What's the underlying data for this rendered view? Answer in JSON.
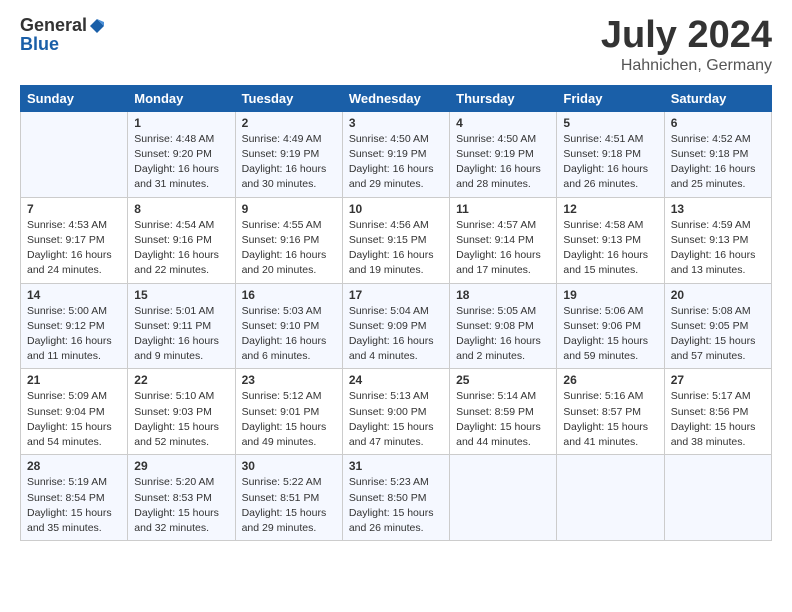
{
  "header": {
    "logo_general": "General",
    "logo_blue": "Blue",
    "month_title": "July 2024",
    "location": "Hahnichen, Germany"
  },
  "days_of_week": [
    "Sunday",
    "Monday",
    "Tuesday",
    "Wednesday",
    "Thursday",
    "Friday",
    "Saturday"
  ],
  "weeks": [
    [
      {
        "day": "",
        "info": ""
      },
      {
        "day": "1",
        "info": "Sunrise: 4:48 AM\nSunset: 9:20 PM\nDaylight: 16 hours\nand 31 minutes."
      },
      {
        "day": "2",
        "info": "Sunrise: 4:49 AM\nSunset: 9:19 PM\nDaylight: 16 hours\nand 30 minutes."
      },
      {
        "day": "3",
        "info": "Sunrise: 4:50 AM\nSunset: 9:19 PM\nDaylight: 16 hours\nand 29 minutes."
      },
      {
        "day": "4",
        "info": "Sunrise: 4:50 AM\nSunset: 9:19 PM\nDaylight: 16 hours\nand 28 minutes."
      },
      {
        "day": "5",
        "info": "Sunrise: 4:51 AM\nSunset: 9:18 PM\nDaylight: 16 hours\nand 26 minutes."
      },
      {
        "day": "6",
        "info": "Sunrise: 4:52 AM\nSunset: 9:18 PM\nDaylight: 16 hours\nand 25 minutes."
      }
    ],
    [
      {
        "day": "7",
        "info": "Sunrise: 4:53 AM\nSunset: 9:17 PM\nDaylight: 16 hours\nand 24 minutes."
      },
      {
        "day": "8",
        "info": "Sunrise: 4:54 AM\nSunset: 9:16 PM\nDaylight: 16 hours\nand 22 minutes."
      },
      {
        "day": "9",
        "info": "Sunrise: 4:55 AM\nSunset: 9:16 PM\nDaylight: 16 hours\nand 20 minutes."
      },
      {
        "day": "10",
        "info": "Sunrise: 4:56 AM\nSunset: 9:15 PM\nDaylight: 16 hours\nand 19 minutes."
      },
      {
        "day": "11",
        "info": "Sunrise: 4:57 AM\nSunset: 9:14 PM\nDaylight: 16 hours\nand 17 minutes."
      },
      {
        "day": "12",
        "info": "Sunrise: 4:58 AM\nSunset: 9:13 PM\nDaylight: 16 hours\nand 15 minutes."
      },
      {
        "day": "13",
        "info": "Sunrise: 4:59 AM\nSunset: 9:13 PM\nDaylight: 16 hours\nand 13 minutes."
      }
    ],
    [
      {
        "day": "14",
        "info": "Sunrise: 5:00 AM\nSunset: 9:12 PM\nDaylight: 16 hours\nand 11 minutes."
      },
      {
        "day": "15",
        "info": "Sunrise: 5:01 AM\nSunset: 9:11 PM\nDaylight: 16 hours\nand 9 minutes."
      },
      {
        "day": "16",
        "info": "Sunrise: 5:03 AM\nSunset: 9:10 PM\nDaylight: 16 hours\nand 6 minutes."
      },
      {
        "day": "17",
        "info": "Sunrise: 5:04 AM\nSunset: 9:09 PM\nDaylight: 16 hours\nand 4 minutes."
      },
      {
        "day": "18",
        "info": "Sunrise: 5:05 AM\nSunset: 9:08 PM\nDaylight: 16 hours\nand 2 minutes."
      },
      {
        "day": "19",
        "info": "Sunrise: 5:06 AM\nSunset: 9:06 PM\nDaylight: 15 hours\nand 59 minutes."
      },
      {
        "day": "20",
        "info": "Sunrise: 5:08 AM\nSunset: 9:05 PM\nDaylight: 15 hours\nand 57 minutes."
      }
    ],
    [
      {
        "day": "21",
        "info": "Sunrise: 5:09 AM\nSunset: 9:04 PM\nDaylight: 15 hours\nand 54 minutes."
      },
      {
        "day": "22",
        "info": "Sunrise: 5:10 AM\nSunset: 9:03 PM\nDaylight: 15 hours\nand 52 minutes."
      },
      {
        "day": "23",
        "info": "Sunrise: 5:12 AM\nSunset: 9:01 PM\nDaylight: 15 hours\nand 49 minutes."
      },
      {
        "day": "24",
        "info": "Sunrise: 5:13 AM\nSunset: 9:00 PM\nDaylight: 15 hours\nand 47 minutes."
      },
      {
        "day": "25",
        "info": "Sunrise: 5:14 AM\nSunset: 8:59 PM\nDaylight: 15 hours\nand 44 minutes."
      },
      {
        "day": "26",
        "info": "Sunrise: 5:16 AM\nSunset: 8:57 PM\nDaylight: 15 hours\nand 41 minutes."
      },
      {
        "day": "27",
        "info": "Sunrise: 5:17 AM\nSunset: 8:56 PM\nDaylight: 15 hours\nand 38 minutes."
      }
    ],
    [
      {
        "day": "28",
        "info": "Sunrise: 5:19 AM\nSunset: 8:54 PM\nDaylight: 15 hours\nand 35 minutes."
      },
      {
        "day": "29",
        "info": "Sunrise: 5:20 AM\nSunset: 8:53 PM\nDaylight: 15 hours\nand 32 minutes."
      },
      {
        "day": "30",
        "info": "Sunrise: 5:22 AM\nSunset: 8:51 PM\nDaylight: 15 hours\nand 29 minutes."
      },
      {
        "day": "31",
        "info": "Sunrise: 5:23 AM\nSunset: 8:50 PM\nDaylight: 15 hours\nand 26 minutes."
      },
      {
        "day": "",
        "info": ""
      },
      {
        "day": "",
        "info": ""
      },
      {
        "day": "",
        "info": ""
      }
    ]
  ]
}
